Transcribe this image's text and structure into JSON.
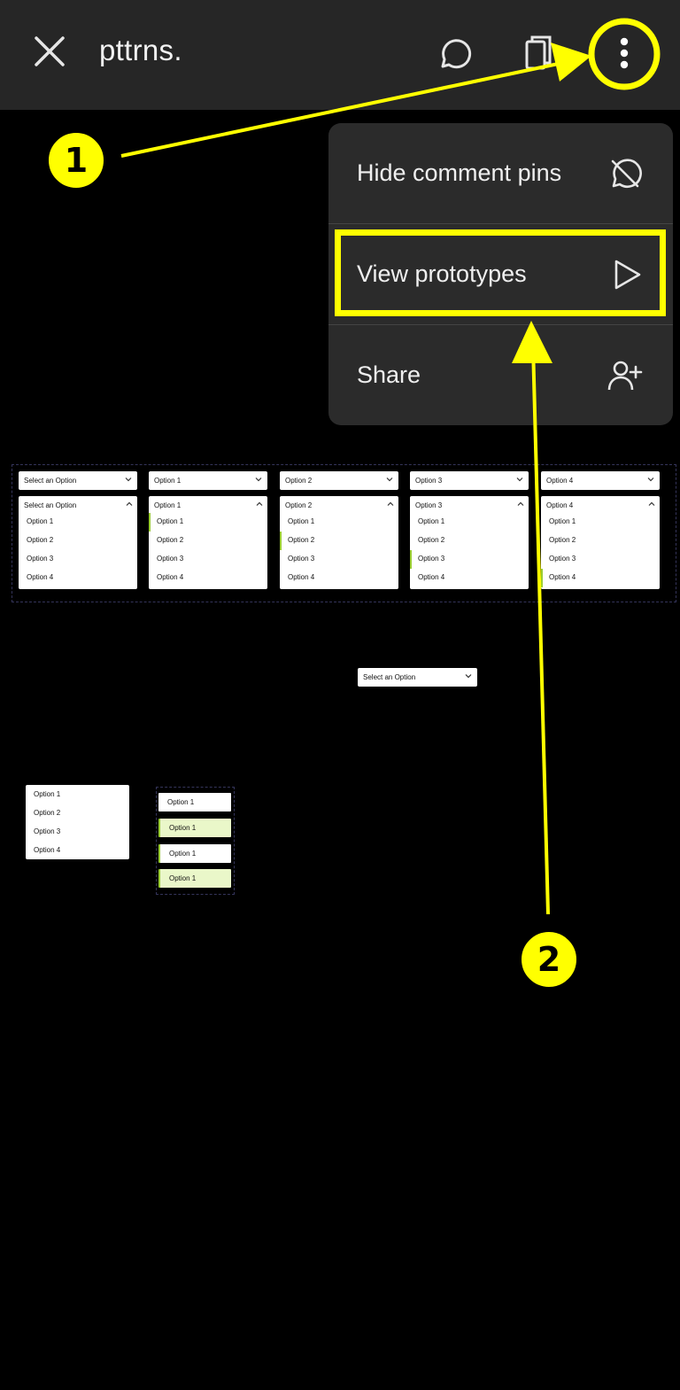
{
  "header": {
    "title": "pttrns.",
    "close_icon": "close-icon",
    "comment_icon": "comment-icon",
    "pages_icon": "pages-icon",
    "more_icon": "more-vertical-icon"
  },
  "menu": {
    "items": [
      {
        "label": "Hide comment pins",
        "icon": "comment-off-icon"
      },
      {
        "label": "View prototypes",
        "icon": "play-icon"
      },
      {
        "label": "Share",
        "icon": "add-user-icon"
      }
    ]
  },
  "annotations": {
    "step1": "1",
    "step2": "2",
    "color": "#ffff00"
  },
  "canvas": {
    "closed_selects": [
      "Select an Option",
      "Option 1",
      "Option 2",
      "Option 3",
      "Option 4"
    ],
    "open_dropdowns": [
      {
        "header": "Select an Option",
        "options": [
          "Option 1",
          "Option 2",
          "Option 3",
          "Option 4"
        ]
      },
      {
        "header": "Option 1",
        "options": [
          "Option 1",
          "Option 2",
          "Option 3",
          "Option 4"
        ]
      },
      {
        "header": "Option 2",
        "options": [
          "Option 1",
          "Option 2",
          "Option 3",
          "Option 4"
        ]
      },
      {
        "header": "Option 3",
        "options": [
          "Option 1",
          "Option 2",
          "Option 3",
          "Option 4"
        ]
      },
      {
        "header": "Option 4",
        "options": [
          "Option 1",
          "Option 2",
          "Option 3",
          "Option 4"
        ]
      }
    ],
    "lone_select": "Select an Option",
    "mini_list": [
      "Option 1",
      "Option 2",
      "Option 3",
      "Option 4"
    ],
    "chips": [
      "Option 1",
      "Option 1",
      "Option 1",
      "Option 1"
    ],
    "accent": "#9acd32",
    "chip_highlight": "#eaf7c9"
  }
}
